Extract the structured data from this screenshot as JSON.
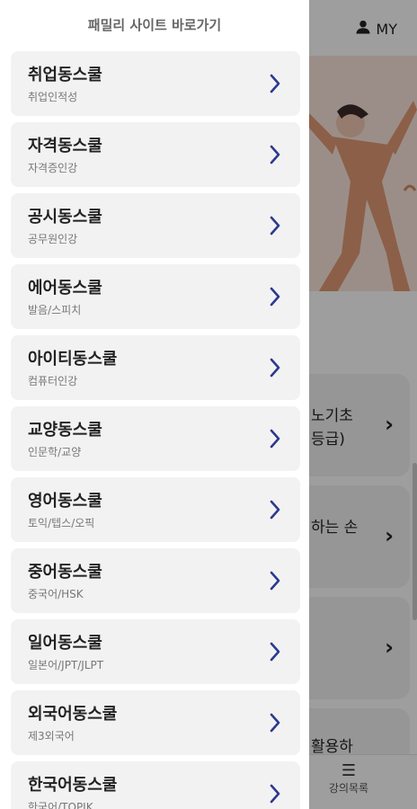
{
  "drawer": {
    "title": "패밀리 사이트 바로가기",
    "items": [
      {
        "name": "취업동스쿨",
        "sub": "취업인적성"
      },
      {
        "name": "자격동스쿨",
        "sub": "자격증인강"
      },
      {
        "name": "공시동스쿨",
        "sub": "공무원인강"
      },
      {
        "name": "에어동스쿨",
        "sub": "발음/스피치"
      },
      {
        "name": "아이티동스쿨",
        "sub": "컴퓨터인강"
      },
      {
        "name": "교양동스쿨",
        "sub": "인문학/교양"
      },
      {
        "name": "영어동스쿨",
        "sub": "토익/텝스/오픽"
      },
      {
        "name": "중어동스쿨",
        "sub": "중국어/HSK"
      },
      {
        "name": "일어동스쿨",
        "sub": "일본어/JPT/JLPT"
      },
      {
        "name": "외국어동스쿨",
        "sub": "제3외국어"
      },
      {
        "name": "한국어동스쿨",
        "sub": "한국어/TOPIK"
      }
    ]
  },
  "header": {
    "my_label": "MY"
  },
  "background_cards": [
    {
      "line1": "노기초",
      "line2": "등급)"
    },
    {
      "line1": "하는 손",
      "line2": ""
    },
    {
      "line1": "",
      "line2": ""
    },
    {
      "line1": "활용하",
      "line2": ""
    }
  ],
  "bottom_nav": {
    "lecture_label": "강의목록"
  },
  "colors": {
    "chevron": "#2b3a8f",
    "overlay": "rgba(0,0,0,0.38)",
    "hero_bg": "#fbe6dc"
  }
}
